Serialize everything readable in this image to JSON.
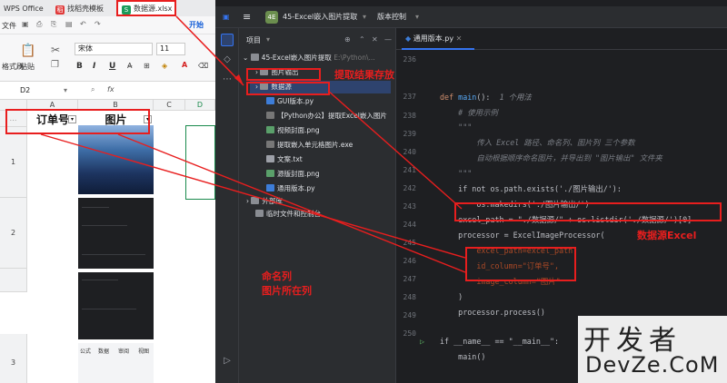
{
  "wps": {
    "tabs": {
      "app": "WPS Office",
      "template": "找稻壳模板",
      "file": "数据源.xlsx"
    },
    "ribbon": {
      "start": "开始",
      "file_menu": "文件",
      "format_painter": "格式刷",
      "paste": "粘贴",
      "font": "宋体",
      "size": "11",
      "bold": "B",
      "italic": "I",
      "underline": "U"
    },
    "formula_bar": {
      "cell_ref": "D2",
      "fx": "fx"
    },
    "columns": [
      "A",
      "B",
      "C",
      "D"
    ],
    "rows": [
      "1",
      "2",
      "3"
    ],
    "header_cells": {
      "id": "订单号",
      "image": "图片"
    },
    "thumb_labels": [
      "公式",
      "数据",
      "审阅",
      "视图"
    ]
  },
  "ide": {
    "project_badge": "4E",
    "project_name": "45-Excel嵌入图片提取",
    "vcs": "版本控制",
    "panel_title": "项目",
    "editor_tab": "通用版本.py",
    "tree": [
      "45-Excel嵌入图片提取",
      "图片输出",
      "数据源",
      "GUI版本.py",
      "【Python办公】提取Excel嵌入图片",
      "视频封面.png",
      "提取嵌入单元格图片.exe",
      "文案.txt",
      "源版封面.png",
      "通用版本.py",
      "外部库",
      "临时文件和控制台"
    ],
    "path_hint": "E:\\Python\\...",
    "lines": [
      "236",
      "237",
      "238",
      "239",
      "240",
      "241",
      "242",
      "243",
      "244",
      "245",
      "246",
      "247",
      "248",
      "249",
      "250"
    ],
    "code": {
      "l236": "def main():",
      "l236_hint": "1 个用法",
      "l237": "    # 使用示例",
      "l238": "    \"\"\"",
      "l239": "        传入 Excel 路径、命名列、图片列 三个参数",
      "l240": "        自动根据顺序命名图片，并导出到 \"图片输出\" 文件夹",
      "l241": "    \"\"\"",
      "l242": "    if not os.path.exists('./图片输出/'):",
      "l243": "        os.makedirs('./图片输出/')",
      "l244": "    excel_path = \"./数据源/\" + os.listdir('./数据源/')[0]",
      "l245": "    processor = ExcelImageProcessor(",
      "l246": "        excel_path=excel_path,",
      "l247": "        id_column=\"订单号\",",
      "l248": "        image_column=\"图片\"",
      "l249": "    )",
      "l250": "    processor.process()",
      "l252": "if __name__ == \"__main__\":",
      "l253": "    main()"
    }
  },
  "annotations": {
    "extract_output": "提取结果存放",
    "data_source": "数据源Excel",
    "name_column": "命名列",
    "image_column": "图片所在列"
  },
  "watermark": {
    "cn": "开发者",
    "en": "DevZe.CoM"
  }
}
